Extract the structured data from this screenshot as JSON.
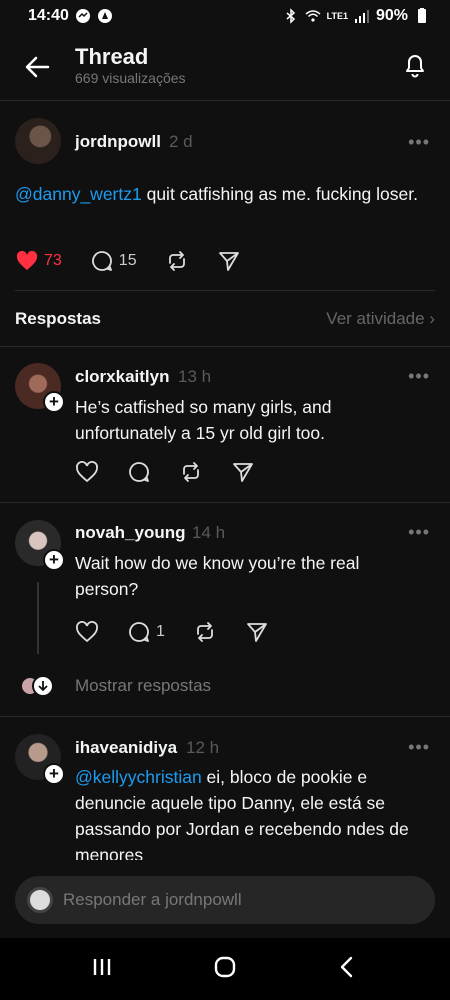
{
  "status": {
    "time": "14:40",
    "battery": "90%",
    "network": "LTE1"
  },
  "header": {
    "title": "Thread",
    "views": "669 visualizações"
  },
  "original_post": {
    "username": "jordnpowll",
    "time": "2 d",
    "mention": "@danny_wertz1",
    "text": " quit catfishing as me. fucking loser.",
    "likes": "73",
    "comments": "15"
  },
  "replies_section": {
    "title": "Respostas",
    "activity_link": "Ver atividade"
  },
  "replies": [
    {
      "username": "clorxkaitlyn",
      "time": "13 h",
      "text": "He’s catfished so many girls, and unfortunately a 15 yr old girl too."
    },
    {
      "username": "novah_young",
      "time": "14 h",
      "text": "Wait how do we know you’re the real person?",
      "comments": "1"
    },
    {
      "username": "ihaveanidiya",
      "time": "12 h",
      "mention": "@kellyychristian",
      "text": " ei, bloco de pookie e denuncie aquele tipo Danny, ele está se passando por Jordan e recebendo ndes de menores"
    }
  ],
  "show_replies": "Mostrar respostas",
  "reply_bar": {
    "placeholder": "Responder a jordnpowll"
  },
  "colors": {
    "background": "#101010",
    "accent_link": "#1d9bf0",
    "like_red": "#ff3040"
  }
}
